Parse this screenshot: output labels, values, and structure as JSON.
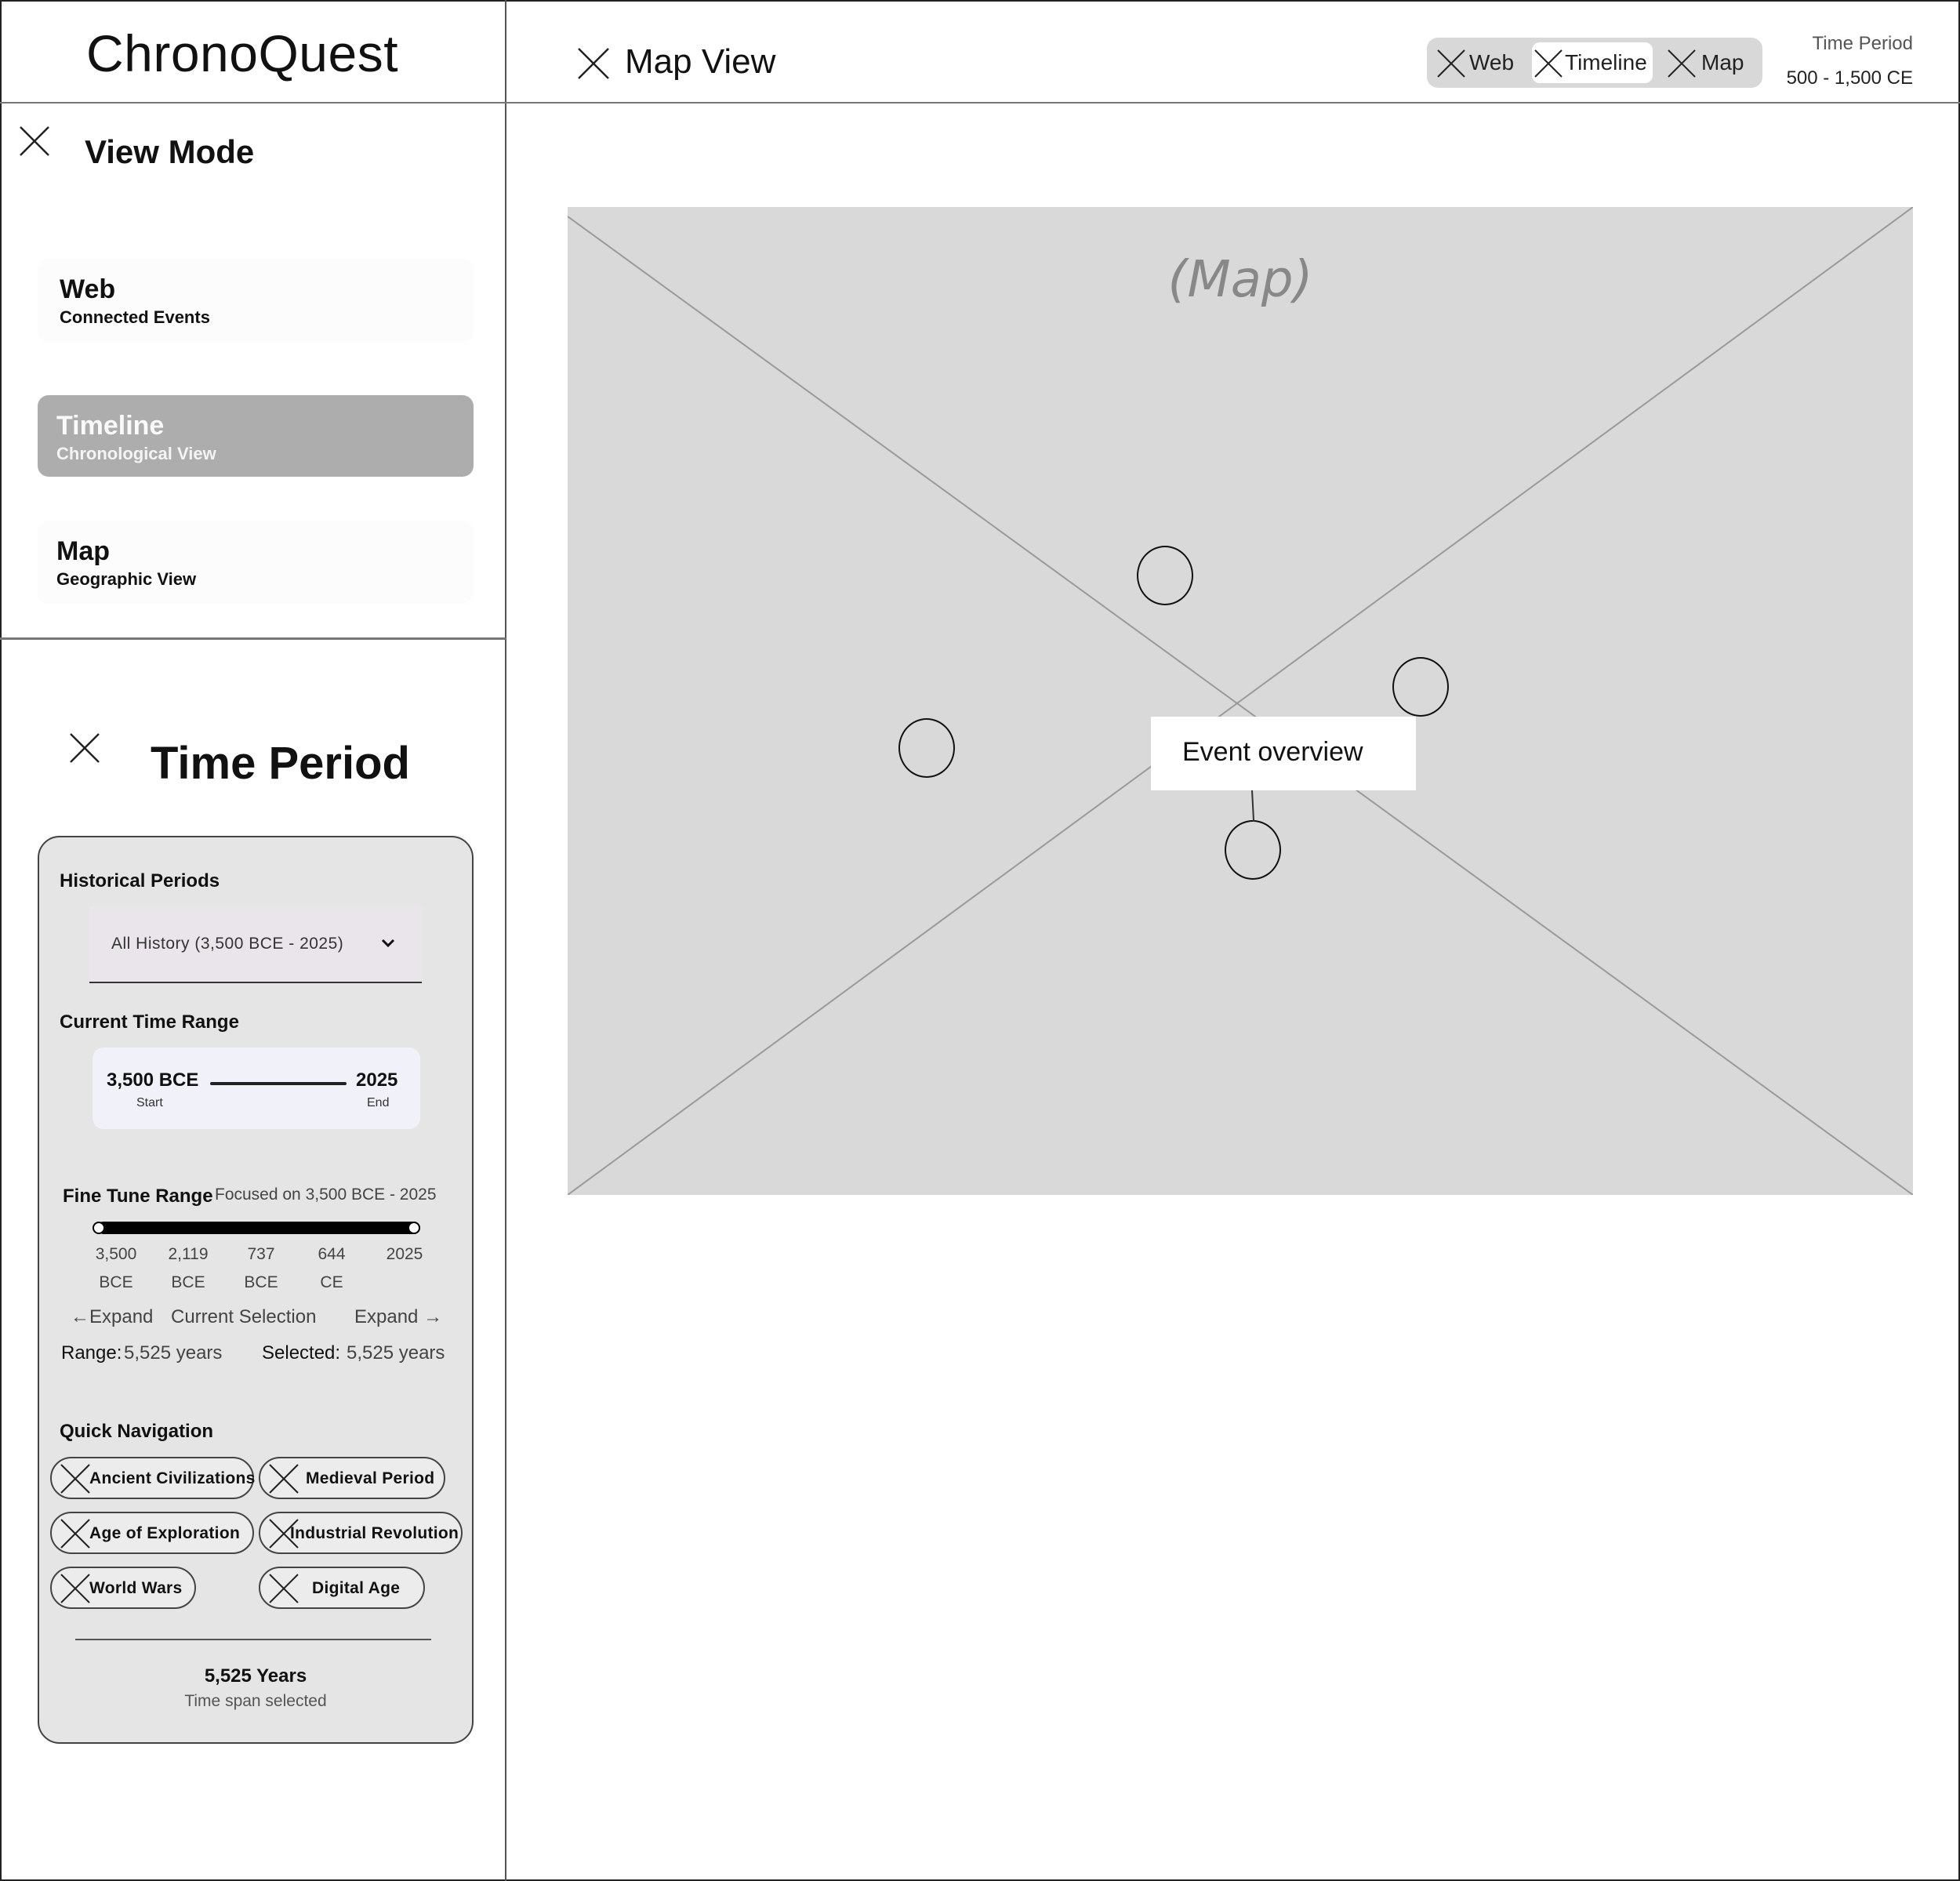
{
  "app": {
    "title": "ChronoQuest"
  },
  "header": {
    "title": "Map View",
    "view_switch": [
      {
        "label": "Web",
        "active": false
      },
      {
        "label": "Timeline",
        "active": true
      },
      {
        "label": "Map",
        "active": false
      }
    ],
    "time_period_label": "Time Period",
    "time_period_value": "500 - 1,500 CE"
  },
  "view_mode": {
    "title": "View Mode",
    "modes": [
      {
        "title": "Web",
        "subtitle": "Connected Events",
        "selected": false
      },
      {
        "title": "Timeline",
        "subtitle": "Chronological View",
        "selected": true
      },
      {
        "title": "Map",
        "subtitle": "Geographic View",
        "selected": false
      }
    ]
  },
  "time_period": {
    "title": "Time Period",
    "historical_periods_label": "Historical Periods",
    "period_select_value": "All History (3,500 BCE - 2025)",
    "current_range_label": "Current Time Range",
    "range_start": "3,500 BCE",
    "range_start_sub": "Start",
    "range_end": "2025",
    "range_end_sub": "End",
    "fine_tune_label": "Fine Tune Range",
    "fine_tune_focus": "Focused on 3,500 BCE - 2025",
    "ticks": [
      {
        "num": "3,500",
        "era": "BCE"
      },
      {
        "num": "2,119",
        "era": "BCE"
      },
      {
        "num": "737",
        "era": "BCE"
      },
      {
        "num": "644",
        "era": "CE"
      },
      {
        "num": "2025",
        "era": ""
      }
    ],
    "expand_left": "←Expand",
    "current_selection": "Current Selection",
    "expand_right": "Expand →",
    "range_label": "Range:",
    "range_value": "5,525 years",
    "selected_label": "Selected:",
    "selected_value": "5,525 years",
    "quick_nav_label": "Quick Navigation",
    "quick_nav": [
      "Ancient Civilizations",
      "Medieval Period",
      "Age of Exploration",
      "Industrial Revolution",
      "World Wars",
      "Digital Age"
    ],
    "span_years": "5,525 Years",
    "span_sub": "Time span selected"
  },
  "map": {
    "caption": "(Map)",
    "event_overview": "Event overview"
  },
  "colors": {
    "selected_mode": "#adadad",
    "map_placeholder": "#d9d9d9",
    "panel": "#e5e5e5"
  }
}
